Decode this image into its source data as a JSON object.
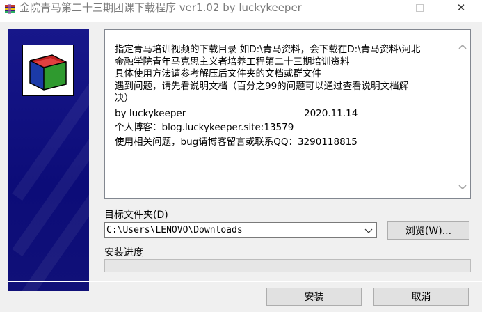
{
  "window": {
    "title": "金院青马第二十三期团课下载程序 ver1.02 by luckykeeper",
    "minimize_glyph": "—",
    "close_glyph": "✕"
  },
  "info": {
    "lines": [
      "指定青马培训视频的下载目录 如D:\\青马资料，会下载在D:\\青马资料\\河北",
      "金融学院青年马克思主义者培养工程第二十三期培训资料",
      "具体使用方法请参考解压后文件夹的文档或群文件",
      "遇到问题，请先看说明文档（百分之99的问题可以通过查看说明文档解",
      "决）"
    ],
    "author": "by luckykeeper",
    "date": "2020.11.14",
    "blog": "个人博客：blog.luckykeeper.site:13579",
    "contact": "使用相关问题，bug请博客留言或联系QQ：3290118815"
  },
  "target_dir": {
    "label": "目标文件夹(D)",
    "value": "C:\\Users\\LENOVO\\Downloads",
    "browse_label": "浏览(W)..."
  },
  "progress": {
    "label": "安装进度",
    "value": 0
  },
  "buttons": {
    "install": "安装",
    "cancel": "取消"
  },
  "colors": {
    "banner": "#0c0c78",
    "window_bg": "#f0f0f0",
    "progress_fill": "#06b025"
  }
}
